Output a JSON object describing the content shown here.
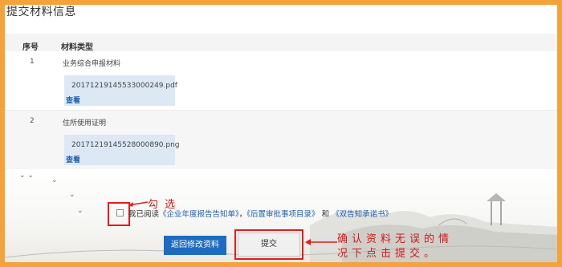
{
  "section_title": "提交材料信息",
  "table": {
    "columns": [
      "序号",
      "材料类型"
    ],
    "rows": [
      {
        "no": "1",
        "type": "业务综合申报材料",
        "file": "20171219145533000249.pdf",
        "view": "查看"
      },
      {
        "no": "2",
        "type": "住所使用证明",
        "file": "20171219145528000890.png",
        "view": "查看"
      }
    ]
  },
  "agreement": {
    "prefix": "我已阅读",
    "doc1": "《企业年度报告告知单》",
    "sep": "，",
    "doc2": "《后置审批事项目录》",
    "and": " 和 ",
    "doc3": "《双告知承诺书》"
  },
  "buttons": {
    "back": "返回修改资料",
    "submit": "提交"
  },
  "annotations": {
    "check": "勾 选",
    "submit": "确认资料无误的情况下点击提交。"
  },
  "colors": {
    "frame": "#f5a23a",
    "accent": "#1f6bc0",
    "annotation": "#d01a1a"
  }
}
